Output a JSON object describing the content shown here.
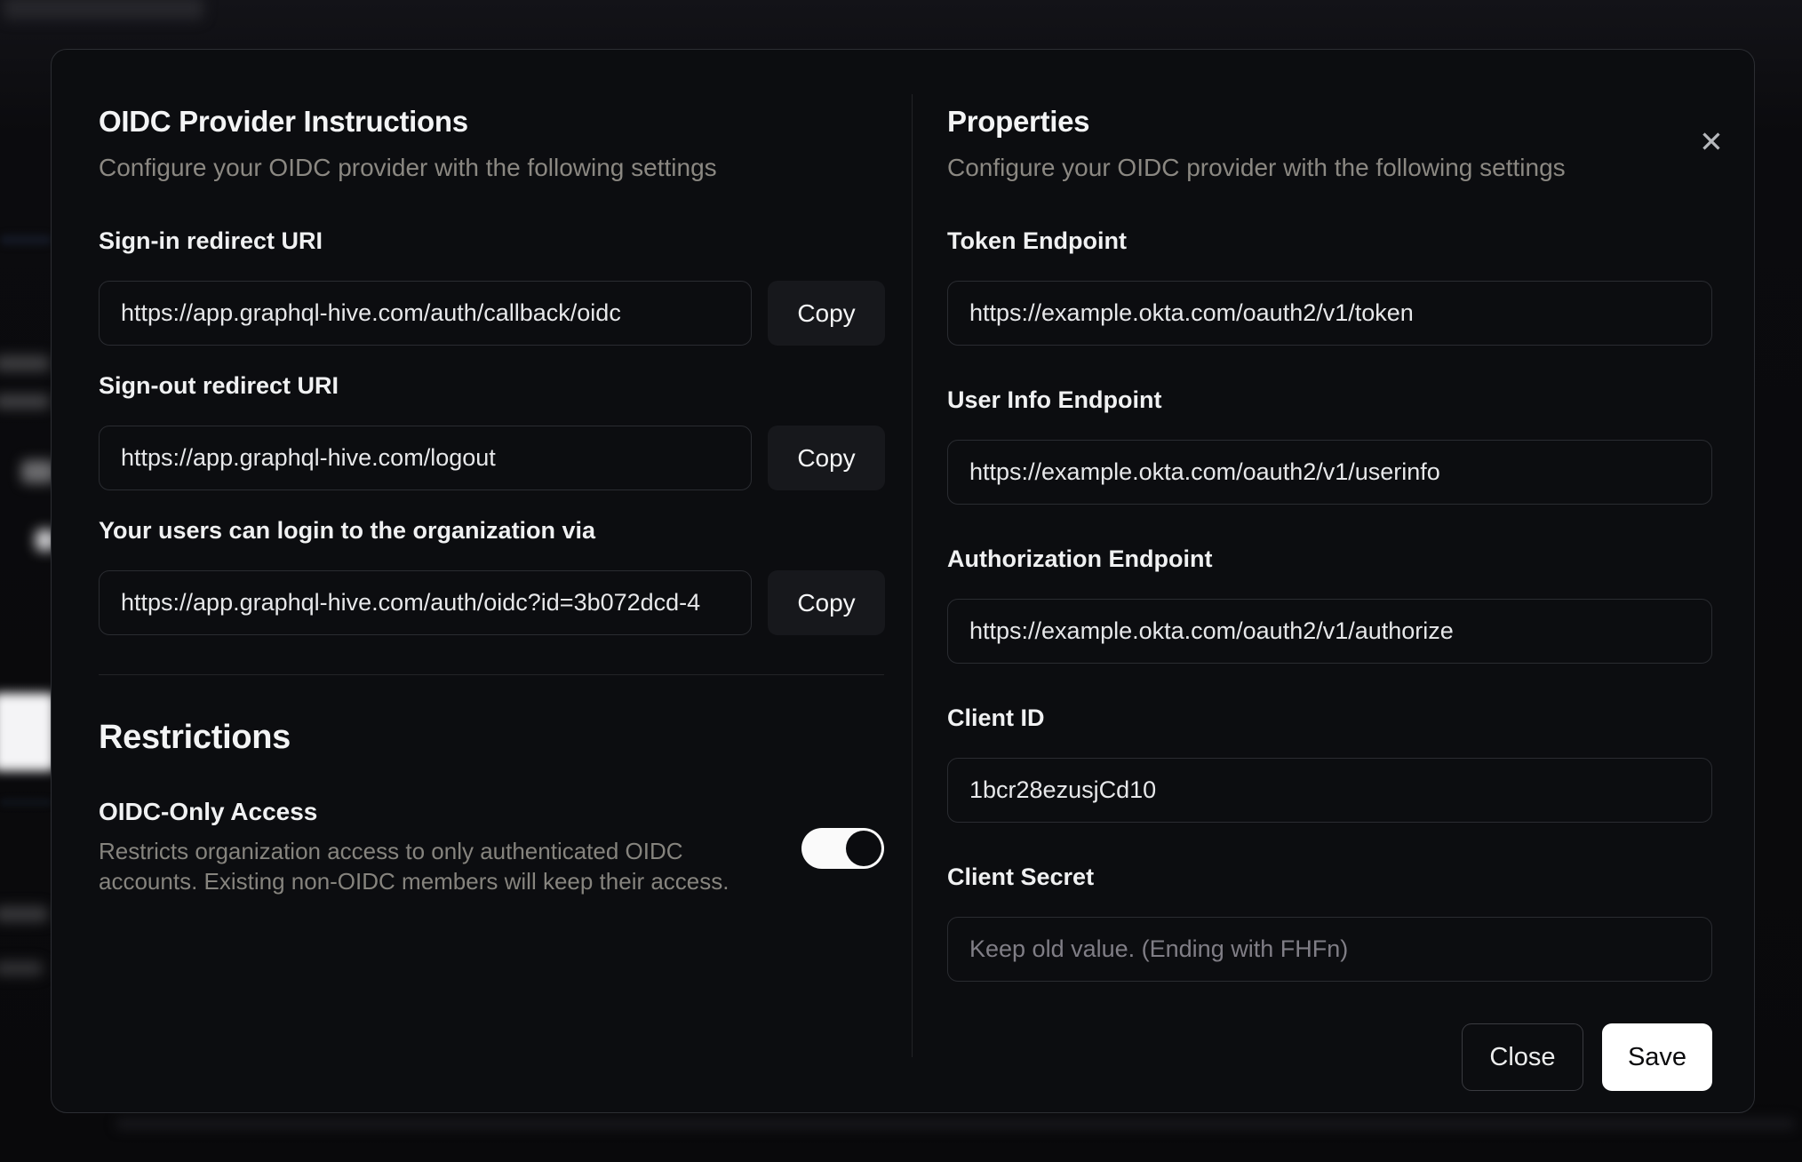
{
  "modal": {
    "close_icon": "✕",
    "left": {
      "title": "OIDC Provider Instructions",
      "subtitle": "Configure your OIDC provider with the following settings",
      "fields": [
        {
          "label": "Sign-in redirect URI",
          "value": "https://app.graphql-hive.com/auth/callback/oidc",
          "copy_label": "Copy"
        },
        {
          "label": "Sign-out redirect URI",
          "value": "https://app.graphql-hive.com/logout",
          "copy_label": "Copy"
        },
        {
          "label": "Your users can login to the organization via",
          "value": "https://app.graphql-hive.com/auth/oidc?id=3b072dcd-4",
          "copy_label": "Copy"
        }
      ],
      "restrictions": {
        "title": "Restrictions",
        "toggle_label": "OIDC-Only Access",
        "toggle_description": "Restricts organization access to only authenticated OIDC accounts. Existing non-OIDC members will keep their access.",
        "toggle_state": "true"
      }
    },
    "right": {
      "title": "Properties",
      "subtitle": "Configure your OIDC provider with the following settings",
      "fields": [
        {
          "label": "Token Endpoint",
          "value": "https://example.okta.com/oauth2/v1/token"
        },
        {
          "label": "User Info Endpoint",
          "value": "https://example.okta.com/oauth2/v1/userinfo"
        },
        {
          "label": "Authorization Endpoint",
          "value": "https://example.okta.com/oauth2/v1/authorize"
        },
        {
          "label": "Client ID",
          "value": "1bcr28ezusjCd10"
        },
        {
          "label": "Client Secret",
          "value": "",
          "placeholder": "Keep old value. (Ending with FHFn)"
        }
      ],
      "buttons": {
        "close": "Close",
        "save": "Save"
      }
    }
  },
  "colors": {
    "modal_background": "#0c0d10",
    "backdrop": "#0a0a0d",
    "border": "#2c2e33",
    "text_primary": "#f0f1f2",
    "text_muted": "#8b8882",
    "save_button": "#ffffff",
    "toggle_track": "#fafafa"
  }
}
